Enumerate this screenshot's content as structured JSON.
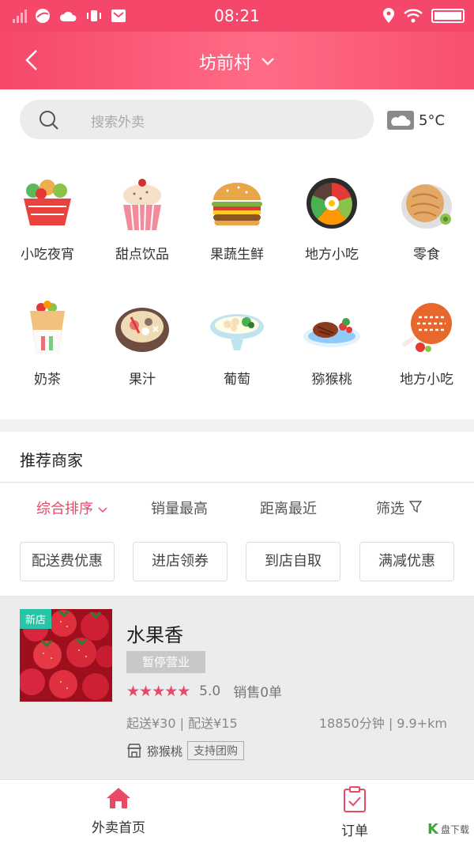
{
  "status_bar": {
    "time": "08:21"
  },
  "header": {
    "title": "坊前村"
  },
  "search": {
    "placeholder": "搜索外卖"
  },
  "weather": {
    "temp": "5°C"
  },
  "categories": [
    {
      "label": "小吃夜宵",
      "icon": "basket-icon"
    },
    {
      "label": "甜点饮品",
      "icon": "cupcake-icon"
    },
    {
      "label": "果蔬生鲜",
      "icon": "burger-icon"
    },
    {
      "label": "地方小吃",
      "icon": "bibimbap-icon"
    },
    {
      "label": "零食",
      "icon": "pancake-icon"
    },
    {
      "label": "奶茶",
      "icon": "wrap-icon"
    },
    {
      "label": "果汁",
      "icon": "hotpot-icon"
    },
    {
      "label": "葡萄",
      "icon": "dumplings-icon"
    },
    {
      "label": "猕猴桃",
      "icon": "steak-icon"
    },
    {
      "label": "地方小吃",
      "icon": "meat-icon"
    }
  ],
  "recommend": {
    "title": "推荐商家"
  },
  "sort": {
    "items": [
      {
        "label": "综合排序",
        "active": true
      },
      {
        "label": "销量最高"
      },
      {
        "label": "距离最近"
      },
      {
        "label": "筛选"
      }
    ]
  },
  "filters": [
    "配送费优惠",
    "进店领券",
    "到店自取",
    "满减优惠"
  ],
  "shop": {
    "tag": "新店",
    "name": "水果香",
    "status": "暂停营业",
    "stars": "★★★★★",
    "rating": "5.0",
    "sales": "销售0单",
    "fees": "起送¥30 | 配送¥15",
    "distance": "18850分钟 | 9.9+km",
    "category": "猕猴桃",
    "badge": "支持团购"
  },
  "tabbar": {
    "home": "外卖首页",
    "orders": "订单"
  },
  "watermark": {
    "text": "盘下载"
  },
  "colors": {
    "brand": "#f5476a",
    "active": "#e94866",
    "new_tag": "#27c5a8"
  }
}
